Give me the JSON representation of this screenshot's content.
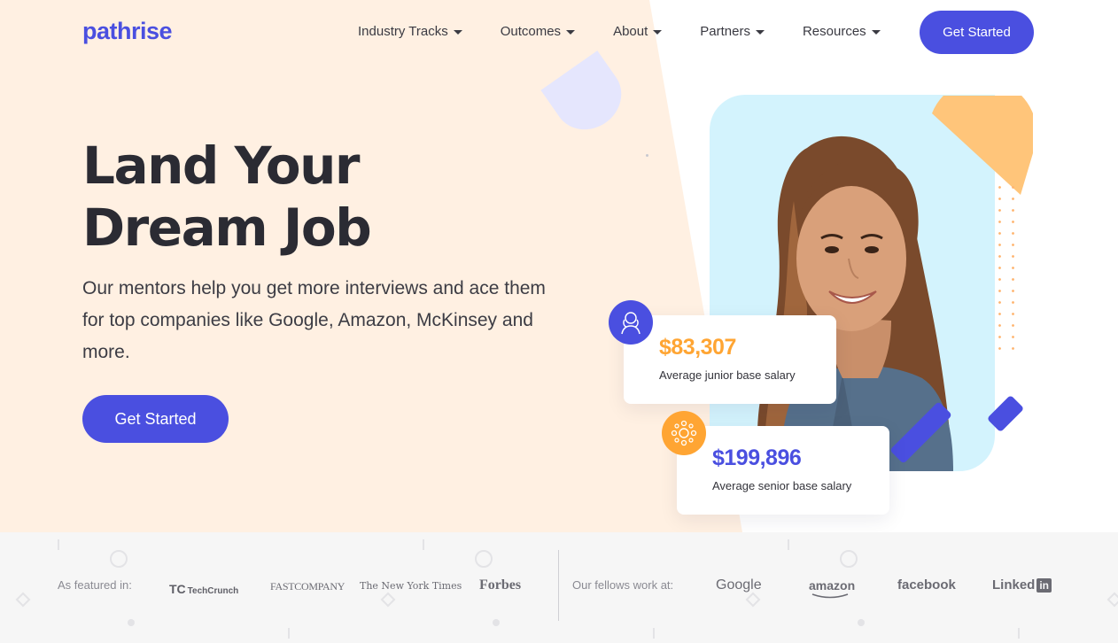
{
  "brand": {
    "logo_text": "pathrise",
    "primary_color": "#4a4fe0",
    "accent_color": "#ffa533",
    "hero_bg": "#fff0e2"
  },
  "nav": {
    "items": [
      {
        "label": "Industry Tracks"
      },
      {
        "label": "Outcomes"
      },
      {
        "label": "About"
      },
      {
        "label": "Partners"
      },
      {
        "label": "Resources"
      }
    ],
    "cta_label": "Get Started"
  },
  "hero": {
    "headline_line1": "Land Your",
    "headline_line2": "Dream Job",
    "subtext": "Our mentors help you get more interviews and ace them for top companies like Google, Amazon, McKinsey and more.",
    "cta_label": "Get Started"
  },
  "stats": [
    {
      "value": "$83,307",
      "label": "Average junior base salary",
      "icon": "mentor-icon",
      "value_color": "#ffa533"
    },
    {
      "value": "$199,896",
      "label": "Average senior base salary",
      "icon": "network-icon",
      "value_color": "#4a4fe0"
    }
  ],
  "featured": {
    "label": "As featured in:",
    "logos": [
      "TechCrunch",
      "FASTCOMPANY",
      "The New York Times",
      "Forbes"
    ]
  },
  "fellows": {
    "label": "Our fellows work at:",
    "logos": [
      "Google",
      "amazon",
      "facebook",
      "Linked"
    ]
  }
}
